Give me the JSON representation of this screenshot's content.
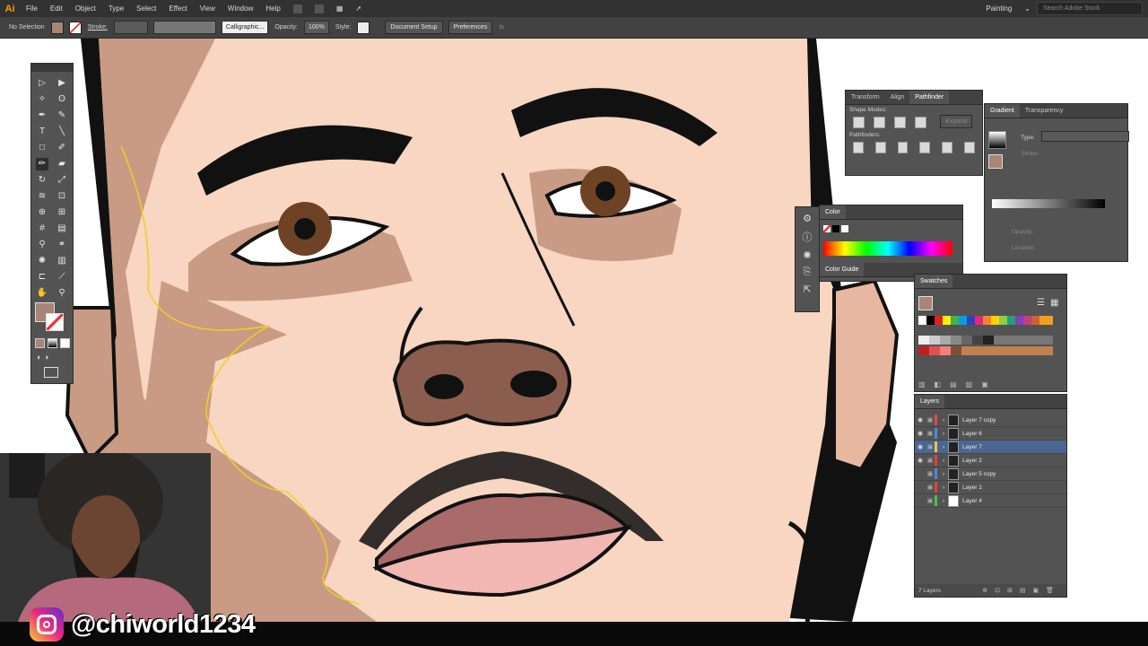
{
  "app": {
    "logo": "Ai"
  },
  "menu": {
    "items": [
      "File",
      "Edit",
      "Object",
      "Type",
      "Select",
      "Effect",
      "View",
      "Window",
      "Help"
    ],
    "workspace": "Painting",
    "search_placeholder": "Search Adobe Stock"
  },
  "control_bar": {
    "selection": "No Selection",
    "stroke_label": "Stroke:",
    "brush": "Calligraphic...",
    "opacity_label": "Opacity:",
    "opacity_value": "100%",
    "style_label": "Style:",
    "doc_setup": "Document Setup",
    "preferences": "Preferences"
  },
  "pathfinder_panel": {
    "tabs": [
      "Transform",
      "Align",
      "Pathfinder"
    ],
    "shape_modes": "Shape Modes:",
    "expand": "Expand",
    "pathfinders": "Pathfinders:"
  },
  "gradient_panel": {
    "tabs": [
      "Gradient",
      "Transparency"
    ],
    "type_label": "Type:",
    "stroke_label": "Stroke:",
    "opacity_label": "Opacity:",
    "location_label": "Location:"
  },
  "color_panel": {
    "tab": "Color",
    "guide_tab": "Color Guide"
  },
  "swatches_panel": {
    "tab": "Swatches"
  },
  "layers_panel": {
    "tab": "Layers",
    "layers": [
      {
        "name": "Layer 7 copy",
        "color": "#e8474a",
        "selected": false
      },
      {
        "name": "Layer 6",
        "color": "#4f87e6",
        "selected": false
      },
      {
        "name": "Layer 7",
        "color": "#e8c547",
        "selected": true
      },
      {
        "name": "Layer 2",
        "color": "#ea3d3d",
        "selected": false
      },
      {
        "name": "Layer 5 copy",
        "color": "#4f87e6",
        "selected": false
      },
      {
        "name": "Layer 1",
        "color": "#ea3d3d",
        "selected": false
      },
      {
        "name": "Layer 4",
        "color": "#45c24d",
        "selected": false
      }
    ],
    "footer": "7 Layers"
  },
  "overlay": {
    "handle": "@chiworld1234"
  },
  "colors": {
    "fill": "#a88575",
    "skin_light": "#f8d6c1",
    "skin_shadow": "#c99b84",
    "skin_dark": "#8a5d4e",
    "lips": "#d69a99"
  }
}
